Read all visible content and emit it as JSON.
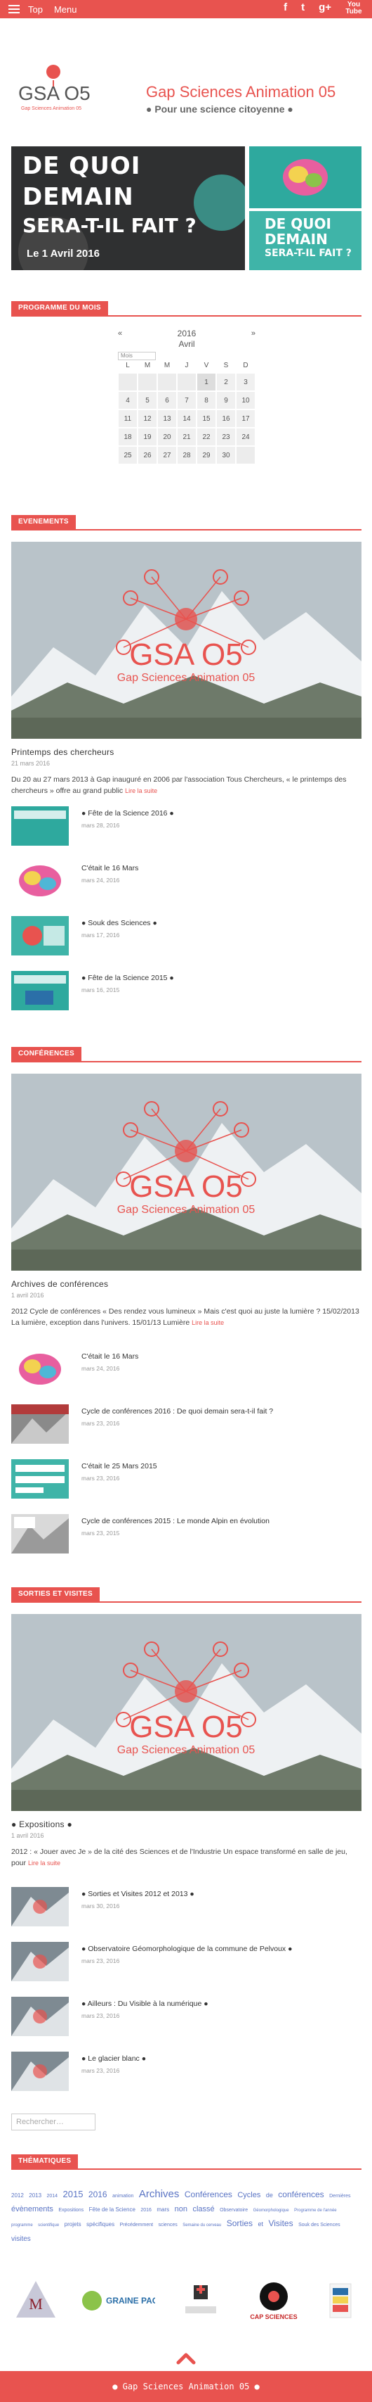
{
  "topbar": {
    "menu_labels": [
      "Top",
      "Menu"
    ],
    "social": [
      "f",
      "t",
      "g+",
      "You Tube"
    ]
  },
  "header": {
    "logo_text": "GSA O5",
    "logo_sub": "Gap Sciences Animation 05",
    "title": "Gap Sciences Animation 05",
    "tagline": "● Pour une science citoyenne ●"
  },
  "banner": {
    "line1": "DE QUOI",
    "line2": "DEMAIN",
    "line3": "SERA-T-IL FAIT ?",
    "date": "Le 1 Avril 2016",
    "thumb2_line1": "DE QUOI",
    "thumb2_line2": "DEMAIN",
    "thumb2_line3": "SERA-T-IL FAIT ?"
  },
  "sections": {
    "programme": "PROGRAMME DU MOIS",
    "evenements": "EVENEMENTS",
    "conferences": "CONFÉRENCES",
    "sorties": "SORTIES ET VISITES",
    "thematiques": "THÉMATIQUES"
  },
  "calendar": {
    "year": "2016",
    "month": "Avril",
    "select_label": "Mois",
    "prev": "«",
    "next": "»",
    "weekdays": [
      "L",
      "M",
      "M",
      "J",
      "V",
      "S",
      "D"
    ],
    "weeks": [
      [
        "",
        "",
        "",
        "",
        "1",
        "2",
        "3"
      ],
      [
        "4",
        "5",
        "6",
        "7",
        "8",
        "9",
        "10"
      ],
      [
        "11",
        "12",
        "13",
        "14",
        "15",
        "16",
        "17"
      ],
      [
        "18",
        "19",
        "20",
        "21",
        "22",
        "23",
        "24"
      ],
      [
        "25",
        "26",
        "27",
        "28",
        "29",
        "30",
        ""
      ]
    ]
  },
  "logo_overlay": {
    "big": "GSA O5",
    "sub": "Gap Sciences Animation 05"
  },
  "evenements": {
    "featured_title": "Printemps des chercheurs",
    "featured_date": "21 mars 2016",
    "excerpt": "Du 20 au 27 mars 2013 à Gap inauguré en 2006 par l'association Tous Chercheurs, « le printemps des chercheurs » offre au grand public",
    "more": "Lire la suite",
    "items": [
      {
        "title": "● Fête de la Science 2016 ●",
        "date": "mars 28, 2016"
      },
      {
        "title": "C'était le 16 Mars",
        "date": "mars 24, 2016"
      },
      {
        "title": "● Souk des Sciences ●",
        "date": "mars 17, 2016"
      },
      {
        "title": "● Fête de la Science 2015 ●",
        "date": "mars 16, 2015"
      }
    ]
  },
  "conferences": {
    "featured_title": "Archives de conférences",
    "featured_date": "1 avril 2016",
    "excerpt": "2012 Cycle de conférences « Des rendez vous lumineux » Mais c'est quoi au juste la lumière ? 15/02/2013 La lumière, exception dans l'univers. 15/01/13 Lumière",
    "more": "Lire la suite",
    "items": [
      {
        "title": "C'était le 16 Mars",
        "date": "mars 24, 2016"
      },
      {
        "title": "Cycle de conférences 2016 : De quoi demain sera-t-il fait ?",
        "date": "mars 23, 2016"
      },
      {
        "title": "C'était le 25 Mars 2015",
        "date": "mars 23, 2016"
      },
      {
        "title": "Cycle de conférences 2015 : Le monde Alpin en évolution",
        "date": "mars 23, 2015"
      }
    ]
  },
  "sorties": {
    "featured_title": "● Expositions ●",
    "featured_date": "1 avril 2016",
    "excerpt": "2012 : « Jouer avec Je » de la cité des Sciences et de l'Industrie Un espace transformé en salle de jeu, pour",
    "more": "Lire la suite",
    "items": [
      {
        "title": "● Sorties et Visites 2012 et 2013 ●",
        "date": "mars 30, 2016"
      },
      {
        "title": "● Observatoire Géomorphologique de la commune de Pelvoux ●",
        "date": "mars 23, 2016"
      },
      {
        "title": "● Ailleurs : Du Visible à la numérique ●",
        "date": "mars 23, 2016"
      },
      {
        "title": "● Le glacier blanc ●",
        "date": "mars 23, 2016"
      }
    ]
  },
  "search_placeholder": "Rechercher…",
  "tags": [
    {
      "t": "2012",
      "s": 8
    },
    {
      "t": "2013",
      "s": 8
    },
    {
      "t": "2014",
      "s": 7
    },
    {
      "t": "2015",
      "s": 13
    },
    {
      "t": "2016",
      "s": 12
    },
    {
      "t": "animation",
      "s": 7
    },
    {
      "t": "Archives",
      "s": 15
    },
    {
      "t": "Conférences",
      "s": 12
    },
    {
      "t": "Cycles",
      "s": 11
    },
    {
      "t": "de",
      "s": 9
    },
    {
      "t": "conférences",
      "s": 12
    },
    {
      "t": "Dernières",
      "s": 7
    },
    {
      "t": "évènements",
      "s": 11
    },
    {
      "t": "Expositions",
      "s": 7
    },
    {
      "t": "Fête de la Science",
      "s": 8
    },
    {
      "t": "2016",
      "s": 7
    },
    {
      "t": "mars",
      "s": 8
    },
    {
      "t": "non",
      "s": 11
    },
    {
      "t": "classé",
      "s": 11
    },
    {
      "t": "Observatoire",
      "s": 7
    },
    {
      "t": "Géomorphologique",
      "s": 6
    },
    {
      "t": "Programme de l'année",
      "s": 6
    },
    {
      "t": "programme",
      "s": 6
    },
    {
      "t": "scientifique",
      "s": 6
    },
    {
      "t": "projets",
      "s": 8
    },
    {
      "t": "spécifiques",
      "s": 8
    },
    {
      "t": "Précédemment",
      "s": 7
    },
    {
      "t": "sciences",
      "s": 7
    },
    {
      "t": "Semaine du cerveau",
      "s": 6
    },
    {
      "t": "Sorties",
      "s": 12
    },
    {
      "t": "et",
      "s": 9
    },
    {
      "t": "Visites",
      "s": 12
    },
    {
      "t": "Souk des Sciences",
      "s": 7
    },
    {
      "t": "visites",
      "s": 10
    }
  ],
  "partners": [
    "M",
    "GRAINE PACA",
    "",
    "CAP SCIENCES",
    ""
  ],
  "footer": "● Gap Sciences Animation 05 ●",
  "colors": {
    "accent": "#e8534f",
    "tag": "#5a74c4"
  }
}
